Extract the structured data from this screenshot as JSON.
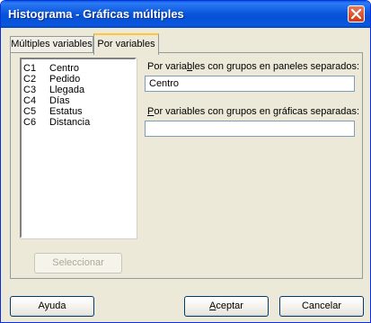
{
  "window": {
    "title": "Histograma - Gráficas múltiples"
  },
  "tabs": [
    {
      "label": "Múltiples variables",
      "selected": false
    },
    {
      "label": "Por variables",
      "selected": true
    }
  ],
  "variables_list": [
    {
      "column": "C1",
      "name": "Centro"
    },
    {
      "column": "C2",
      "name": "Pedido"
    },
    {
      "column": "C3",
      "name": "Llegada"
    },
    {
      "column": "C4",
      "name": "Días"
    },
    {
      "column": "C5",
      "name": "Estatus"
    },
    {
      "column": "C6",
      "name": "Distancia"
    }
  ],
  "panel_groups": {
    "label_pre": "Por varia",
    "label_accel": "b",
    "label_post": "les con grupos en paneles separados:",
    "value": "Centro"
  },
  "graph_groups": {
    "label_accel": "P",
    "label_post": "or variables con grupos en gráficas separadas:",
    "value": ""
  },
  "buttons": {
    "select_label": "Seleccionar",
    "help_label": "Ayuda",
    "ok_accel": "A",
    "ok_rest": "ceptar",
    "cancel_label": "Cancelar"
  },
  "colors": {
    "dialog_face": "#ECE9D8",
    "titlebar_blue": "#0550D6",
    "close_red": "#CE3A16",
    "active_tab_highlight": "#FFC83C"
  },
  "icons": {
    "close": "x-close-icon"
  }
}
